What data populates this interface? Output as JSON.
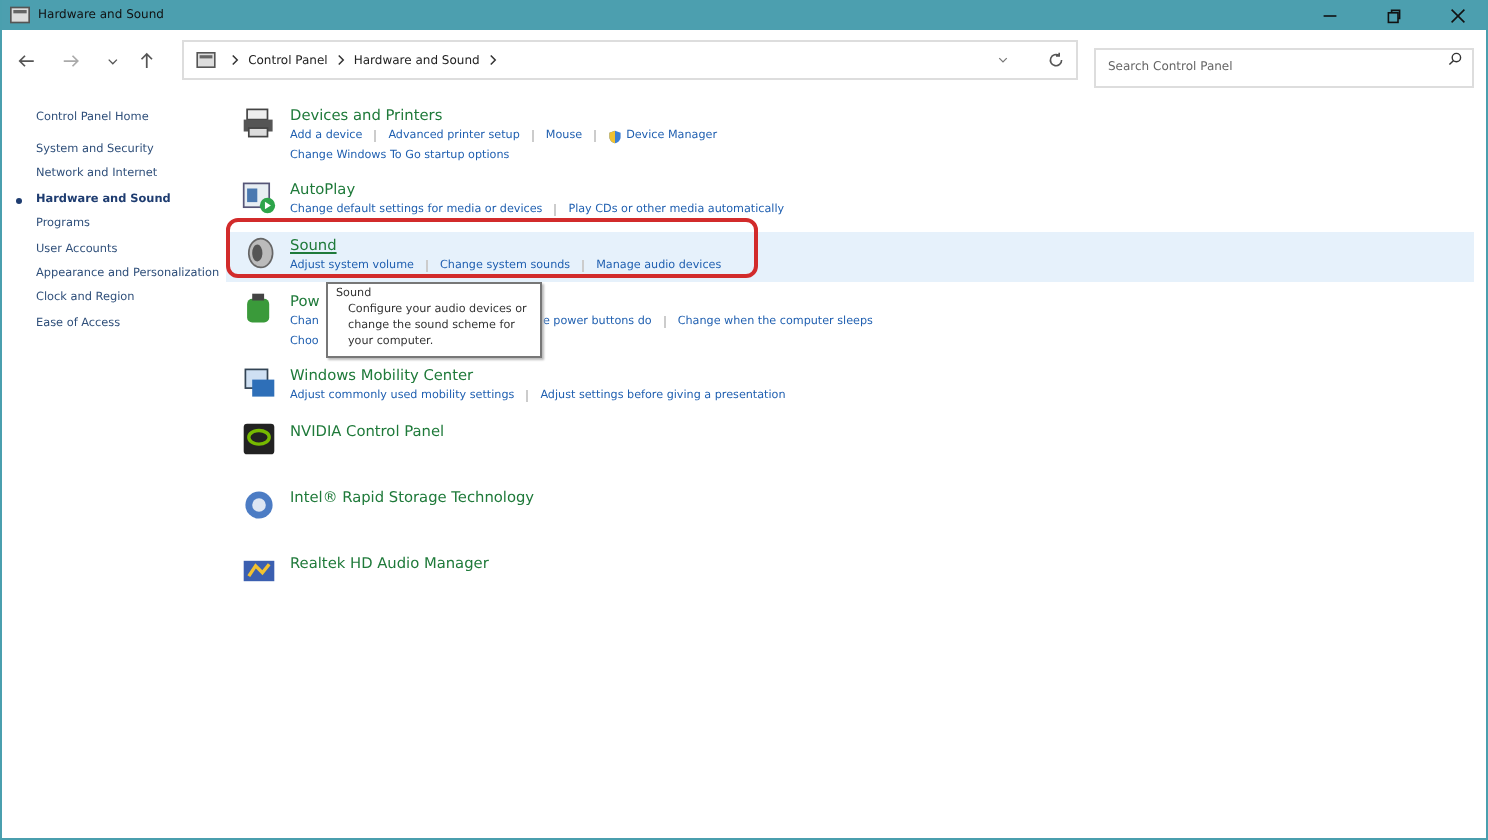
{
  "window": {
    "title": "Hardware and Sound"
  },
  "address": {
    "crumbs": [
      "Control Panel",
      "Hardware and Sound"
    ]
  },
  "search": {
    "placeholder": "Search Control Panel"
  },
  "sidebar": {
    "home": "Control Panel Home",
    "items": [
      {
        "label": "System and Security",
        "selected": false
      },
      {
        "label": "Network and Internet",
        "selected": false
      },
      {
        "label": "Hardware and Sound",
        "selected": true
      },
      {
        "label": "Programs",
        "selected": false
      },
      {
        "label": "User Accounts",
        "selected": false
      },
      {
        "label": "Appearance and Personalization",
        "selected": false
      },
      {
        "label": "Clock and Region",
        "selected": false
      },
      {
        "label": "Ease of Access",
        "selected": false
      }
    ]
  },
  "sections": [
    {
      "title": "Devices and Printers",
      "highlighted": false,
      "covered": false,
      "lines": [
        [
          {
            "text": "Add a device",
            "shield": false
          },
          {
            "text": "Advanced printer setup",
            "shield": false
          },
          {
            "text": "Mouse",
            "shield": false
          },
          {
            "text": "Device Manager",
            "shield": true
          }
        ],
        [
          {
            "text": "Change Windows To Go startup options",
            "shield": false
          }
        ]
      ]
    },
    {
      "title": "AutoPlay",
      "highlighted": false,
      "covered": false,
      "lines": [
        [
          {
            "text": "Change default settings for media or devices",
            "shield": false
          },
          {
            "text": "Play CDs or other media automatically",
            "shield": false
          }
        ]
      ]
    },
    {
      "title": "Sound",
      "highlighted": true,
      "covered": false,
      "lines": [
        [
          {
            "text": "Adjust system volume",
            "shield": false
          },
          {
            "text": "Change system sounds",
            "shield": false
          },
          {
            "text": "Manage audio devices",
            "shield": false
          }
        ]
      ]
    },
    {
      "title": "Pow",
      "highlighted": false,
      "covered": true,
      "lines": [
        [
          {
            "text": "Chan",
            "shield": false
          },
          {
            "text": "e power buttons do",
            "shield": false
          },
          {
            "text": "Change when the computer sleeps",
            "shield": false
          }
        ],
        [
          {
            "text": "Choo",
            "shield": false
          }
        ]
      ]
    },
    {
      "title": "Windows Mobility Center",
      "highlighted": false,
      "covered": false,
      "lines": [
        [
          {
            "text": "Adjust commonly used mobility settings",
            "shield": false
          },
          {
            "text": "Adjust settings before giving a presentation",
            "shield": false
          }
        ]
      ]
    },
    {
      "title": "NVIDIA Control Panel",
      "highlighted": false
    },
    {
      "title": "Intel® Rapid Storage Technology",
      "highlighted": false
    },
    {
      "title": "Realtek HD Audio Manager",
      "highlighted": false
    }
  ],
  "tooltip": {
    "title": "Sound",
    "text": "Configure your audio devices or change the sound scheme for your computer."
  }
}
